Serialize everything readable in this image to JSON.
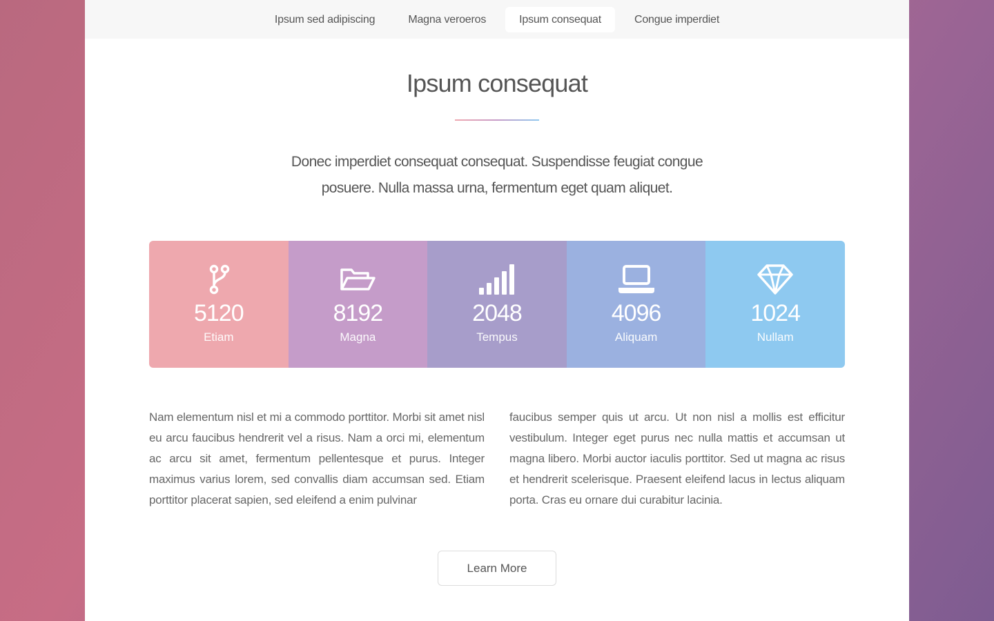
{
  "nav": {
    "items": [
      {
        "label": "Ipsum sed adipiscing",
        "active": false
      },
      {
        "label": "Magna veroeros",
        "active": false
      },
      {
        "label": "Ipsum consequat",
        "active": true
      },
      {
        "label": "Congue imperdiet",
        "active": false
      }
    ]
  },
  "main": {
    "title": "Ipsum consequat",
    "lead": "Donec imperdiet consequat consequat. Suspendisse feugiat congue posuere. Nulla massa urna, fermentum eget quam aliquet.",
    "stats": [
      {
        "icon": "code-branch-icon",
        "value": "5120",
        "label": "Etiam",
        "color": "#eea8ae"
      },
      {
        "icon": "folder-open-icon",
        "value": "8192",
        "label": "Magna",
        "color": "#c59cc9"
      },
      {
        "icon": "signal-icon",
        "value": "2048",
        "label": "Tempus",
        "color": "#a79dca"
      },
      {
        "icon": "laptop-icon",
        "value": "4096",
        "label": "Aliquam",
        "color": "#9bb1e0"
      },
      {
        "icon": "diamond-icon",
        "value": "1024",
        "label": "Nullam",
        "color": "#8ec9f0"
      }
    ],
    "column_left": "Nam elementum nisl et mi a commodo porttitor. Morbi sit amet nisl eu arcu faucibus hendrerit vel a risus. Nam a orci mi, elementum ac arcu sit amet, fermentum pellentesque et purus. Integer maximus varius lorem, sed convallis diam accumsan sed. Etiam porttitor placerat sapien, sed eleifend a enim pulvinar",
    "column_right": "faucibus semper quis ut arcu. Ut non nisl a mollis est efficitur vestibulum. Integer eget purus nec nulla mattis et accumsan ut magna libero. Morbi auctor iaculis porttitor. Sed ut magna ac risus et hendrerit scelerisque. Praesent eleifend lacus in lectus aliquam porta. Cras eu ornare dui curabitur lacinia.",
    "button_label": "Learn More"
  }
}
